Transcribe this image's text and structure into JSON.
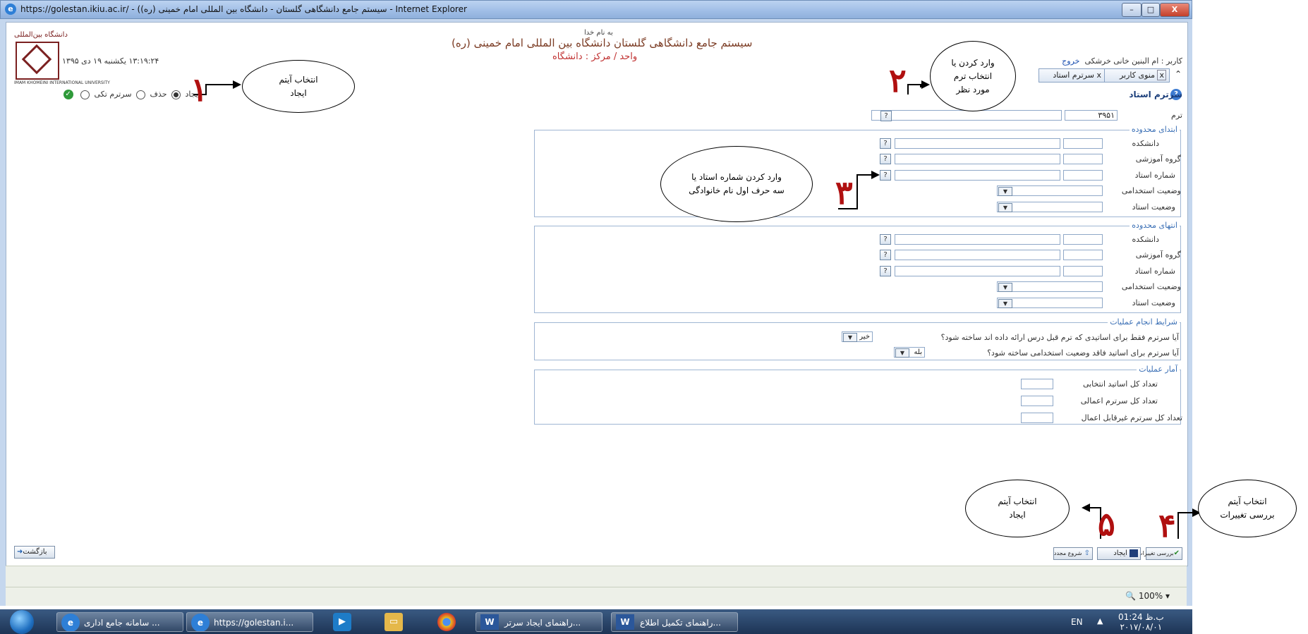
{
  "window": {
    "title": "https://golestan.ikiu.ac.ir/ - (سیستم جامع دانشگاهی گلستان - دانشگاه بین المللی امام خمینی (ره) - Internet Explorer",
    "min": "–",
    "max": "□",
    "close": "X"
  },
  "header": {
    "bismillah": "به نام خدا",
    "system_title": "سیستم جامع دانشگاهی گلستان   دانشگاه بین المللی امام خمینی (ره)",
    "unit": "واحد / مرکز : دانشگاه",
    "datetime": "۱۳:۱۹:۲۴ یکشنبه ۱۹ دی ۱۳۹۵",
    "user_prefix": "کاربر : ام البنین خانی خرشکی",
    "logout": "خروج",
    "logo_script": "دانشگاه بین‌المللی",
    "logo_caption": "IMAM KHOMEINI INTERNATIONAL UNIVERSITY"
  },
  "tabs": [
    {
      "label": "منوی کاربر",
      "close": "x"
    },
    {
      "label": "سرترم استاد",
      "close": "x"
    }
  ],
  "mode": {
    "create": "ایجاد",
    "delete": "حذف",
    "single": "سرترم تکی",
    "selected": "create"
  },
  "form": {
    "title": "سرترم استاد",
    "term_label": "ترم",
    "term_value": "۳۹۵۱",
    "range_start": {
      "legend": "ابتدای محدوده",
      "faculty": "دانشکده",
      "group": "گروه آموزشی",
      "prof_no": "شماره استاد",
      "employment": "وضعیت استخدامی",
      "status": "وضعیت استاد"
    },
    "range_end": {
      "legend": "انتهای محدوده",
      "faculty": "دانشکده",
      "group": "گروه آموزشی",
      "prof_no": "شماره استاد",
      "employment": "وضعیت استخدامی",
      "status": "وضعیت استاد"
    },
    "conditions": {
      "legend": "شرایط انجام عملیات",
      "q1": "آیا سرترم فقط برای اساتیدی که ترم قبل درس ارائه داده اند ساخته شود؟",
      "q1_value": "خیر",
      "q2": "آیا سرترم برای اساتید فاقد وضعیت استخدامی ساخته شود؟",
      "q2_value": "بله"
    },
    "stats": {
      "legend": "آمار عملیات",
      "total_selected": "تعداد کل اساتید انتخابی",
      "total_applied": "تعداد کل سرترم اعمالی",
      "total_not_applied": "تعداد کل سرترم غیرقابل اعمال"
    },
    "help": "?",
    "dropdown": "▼"
  },
  "buttons": {
    "review": "بررسی تغییرات",
    "create": "ایجاد",
    "restart": "شروع مجدد",
    "back": "بازگشت"
  },
  "annotations": {
    "a1": {
      "text_line1": "انتخاب آیتم",
      "text_line2": "ایجاد",
      "num": "۱"
    },
    "a2": {
      "text_line1": "وارد کردن یا",
      "text_line2": "انتخاب  ترم",
      "text_line3": "مورد نظر",
      "num": "۲"
    },
    "a3": {
      "text_line1": "وارد کردن شماره استاد یا",
      "text_line2": "سه حرف اول نام خانوادگی",
      "num": "۳"
    },
    "a4": {
      "text_line1": "انتخاب آیتم",
      "text_line2": "بررسی تغییرات",
      "num": "۴"
    },
    "a5": {
      "text_line1": "انتخاب آیتم",
      "text_line2": "ایجاد",
      "num": "۵"
    }
  },
  "statusbar": {
    "zoom": "100%"
  },
  "taskbar": {
    "items": [
      {
        "label": "... سامانه جامع اداری"
      },
      {
        "label": "https://golestan.i..."
      },
      {
        "label": "...راهنمای ایجاد سرتر"
      },
      {
        "label": "...راهنمای تکمیل اطلاع"
      }
    ],
    "lang": "EN",
    "time": "ب.ظ 01:24",
    "date": "۲۰۱۷/۰۸/۰۱"
  },
  "colors": {
    "accent_blue": "#3a6fb5",
    "annotation_red": "#b01010",
    "title_brown": "#7a3a22"
  }
}
